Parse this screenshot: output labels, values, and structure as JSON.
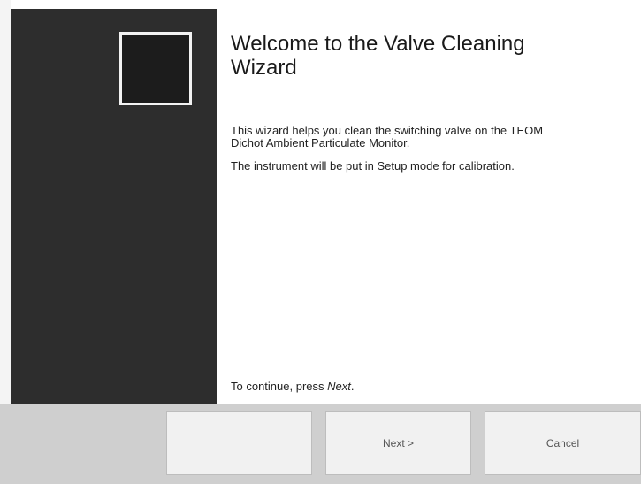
{
  "wizard": {
    "title": "Welcome to the Valve Cleaning Wizard",
    "intro": "This wizard helps you clean the switching valve on the TEOM Dichot Ambient Particulate Monitor.",
    "note": "The instrument will be put in Setup mode for calibration.",
    "continue_prefix": "To continue, press ",
    "continue_action": "Next",
    "continue_suffix": "."
  },
  "buttons": {
    "back_label": "",
    "next_label": "Next >",
    "cancel_label": "Cancel"
  },
  "colors": {
    "side_panel": "#2d2d2d",
    "button_bar": "#cfcfcf",
    "button_face": "#f1f1f1"
  }
}
